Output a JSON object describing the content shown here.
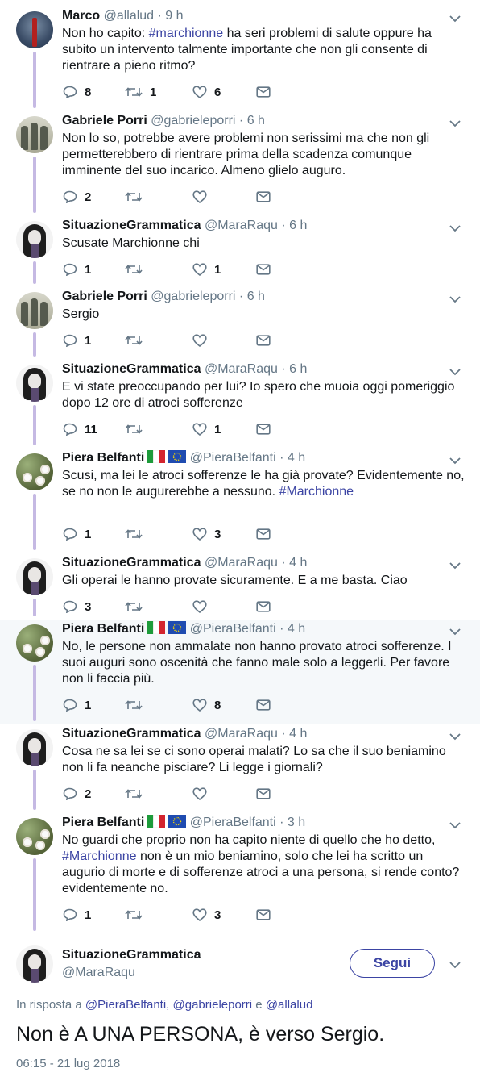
{
  "tweets": [
    {
      "name": "Marco",
      "handle": "@allalud",
      "time": "9 h",
      "avatar": "marco",
      "flags": false,
      "hl": false,
      "parts": [
        {
          "t": "Non ho capito: "
        },
        {
          "t": "#marchionne",
          "tag": true
        },
        {
          "t": " ha seri problemi di salute oppure ha subito un intervento talmente importante che non gli consente di rientrare a pieno ritmo?"
        }
      ],
      "replies": "8",
      "retweets": "1",
      "likes": "6"
    },
    {
      "name": "Gabriele Porri",
      "handle": "@gabrieleporri",
      "time": "6 h",
      "avatar": "porri",
      "flags": false,
      "hl": false,
      "parts": [
        {
          "t": "Non lo so, potrebbe avere problemi non serissimi ma che non gli permetterebbero di rientrare prima della scadenza comunque imminente del suo incarico. Almeno glielo auguro."
        }
      ],
      "replies": "2",
      "retweets": "",
      "likes": ""
    },
    {
      "name": "SituazioneGrammatica",
      "handle": "@MaraRaqu",
      "time": "6 h",
      "avatar": "sg",
      "flags": false,
      "hl": false,
      "parts": [
        {
          "t": "Scusate Marchionne chi"
        }
      ],
      "replies": "1",
      "retweets": "",
      "likes": "1"
    },
    {
      "name": "Gabriele Porri",
      "handle": "@gabrieleporri",
      "time": "6 h",
      "avatar": "porri",
      "flags": false,
      "hl": false,
      "parts": [
        {
          "t": "Sergio"
        }
      ],
      "replies": "1",
      "retweets": "",
      "likes": ""
    },
    {
      "name": "SituazioneGrammatica",
      "handle": "@MaraRaqu",
      "time": "6 h",
      "avatar": "sg",
      "flags": false,
      "hl": false,
      "parts": [
        {
          "t": "E vi state preoccupando per lui? Io spero che muoia oggi pomeriggio dopo 12 ore di atroci sofferenze"
        }
      ],
      "replies": "11",
      "retweets": "",
      "likes": "1"
    },
    {
      "name": "Piera Belfanti",
      "handle": "@PieraBelfanti",
      "time": "4 h",
      "avatar": "pb",
      "flags": true,
      "hl": false,
      "parts": [
        {
          "t": "Scusi, ma lei le atroci sofferenze le ha già provate? Evidentemente no, se no non le augurerebbe a nessuno. "
        },
        {
          "t": "#Marchionne",
          "tag": true
        }
      ],
      "replies": "1",
      "retweets": "",
      "likes": "3"
    },
    {
      "name": "SituazioneGrammatica",
      "handle": "@MaraRaqu",
      "time": "4 h",
      "avatar": "sg",
      "flags": false,
      "hl": false,
      "parts": [
        {
          "t": "Gli operai le hanno provate sicuramente. E a me basta. Ciao"
        }
      ],
      "replies": "3",
      "retweets": "",
      "likes": ""
    },
    {
      "name": "Piera Belfanti",
      "handle": "@PieraBelfanti",
      "time": "4 h",
      "avatar": "pb",
      "flags": true,
      "hl": true,
      "parts": [
        {
          "t": "No, le persone non ammalate non hanno provato atroci sofferenze. I suoi auguri sono oscenità che fanno male solo a leggerli. Per favore non li faccia più."
        }
      ],
      "replies": "1",
      "retweets": "",
      "likes": "8"
    },
    {
      "name": "SituazioneGrammatica",
      "handle": "@MaraRaqu",
      "time": "4 h",
      "avatar": "sg",
      "flags": false,
      "hl": false,
      "parts": [
        {
          "t": "Cosa ne sa lei se ci sono operai malati? Lo sa che il suo beniamino non li fa neanche pisciare? Li legge i giornali?"
        }
      ],
      "replies": "2",
      "retweets": "",
      "likes": ""
    },
    {
      "name": "Piera Belfanti",
      "handle": "@PieraBelfanti",
      "time": "3 h",
      "avatar": "pb",
      "flags": true,
      "hl": false,
      "parts": [
        {
          "t": "No guardi che proprio non ha capito niente di quello che ho detto, "
        },
        {
          "t": "#Marchionne",
          "tag": true
        },
        {
          "t": " non è un mio beniamino, solo che lei ha scritto un augurio di morte e di sofferenze atroci a una persona, si rende conto? evidentemente no."
        }
      ],
      "replies": "1",
      "retweets": "",
      "likes": "3"
    }
  ],
  "main": {
    "name": "SituazioneGrammatica",
    "handle": "@MaraRaqu",
    "follow_label": "Segui",
    "in_reply_prefix": "In risposta a",
    "in_reply_user1": "@PieraBelfanti",
    "in_reply_sep1": ",",
    "in_reply_user2": "@gabrieleporri",
    "in_reply_and": "e",
    "in_reply_user3": "@allalud",
    "text": "Non è A UNA PERSONA, è verso Sergio.",
    "timestamp": "06:15 - 21 lug 2018"
  },
  "colors": {
    "accent": "#3b44a3",
    "thread_line": "#c5b9e3",
    "muted": "#657786",
    "highlight_bg": "#f5f8fa"
  },
  "icons": [
    "reply-icon",
    "retweet-icon",
    "like-icon",
    "direct-message-icon",
    "chevron-down-icon",
    "italy-flag-icon",
    "eu-flag-icon"
  ]
}
